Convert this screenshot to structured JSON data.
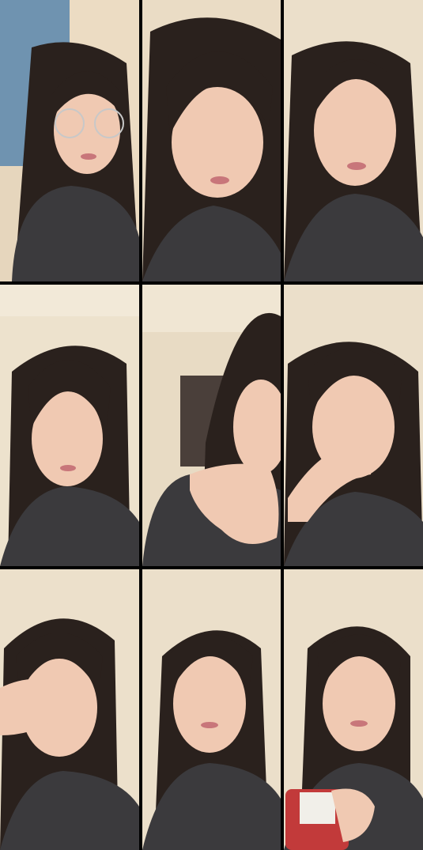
{
  "image": {
    "kind": "photo-collage",
    "rows": 3,
    "columns": 3,
    "frames": [
      {
        "id": 1,
        "subject": "person-with-glasses",
        "background": "window-curtain"
      },
      {
        "id": 2,
        "subject": "person-head-tilted",
        "background": "room-wall"
      },
      {
        "id": 3,
        "subject": "person-closeup",
        "background": "room-wall"
      },
      {
        "id": 4,
        "subject": "person-looking-down",
        "background": "room-wall"
      },
      {
        "id": 5,
        "subject": "person-hand-near-face",
        "background": "room-door"
      },
      {
        "id": 6,
        "subject": "person-hand-on-mouth",
        "background": "room-wall"
      },
      {
        "id": 7,
        "subject": "person-hand-on-face",
        "background": "room-wall"
      },
      {
        "id": 8,
        "subject": "person-eyes-closed",
        "background": "room-wall"
      },
      {
        "id": 9,
        "subject": "person-holding-can",
        "background": "room-wall"
      }
    ],
    "colors": {
      "divider": "#000000",
      "wall": "#e9dcc6",
      "skin": "#f0c9b2",
      "hair": "#2a211d",
      "shirt": "#3b3a3d",
      "curtain": "#6f93b0"
    }
  }
}
